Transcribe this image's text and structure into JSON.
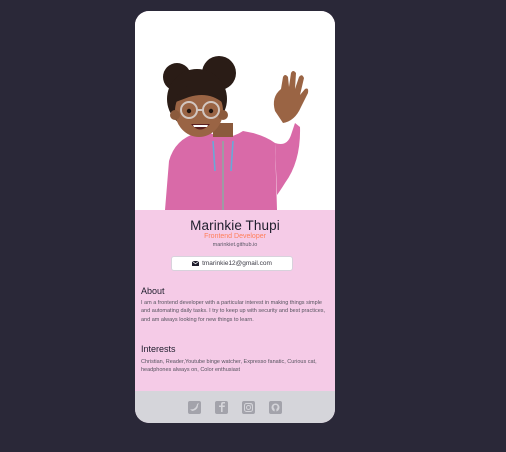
{
  "profile": {
    "name": "Marinkie Thupi",
    "role": "Frontend Developer",
    "website": "marinkiet.github.io",
    "email": "tmarinkie12@gmail.com"
  },
  "about": {
    "title": "About",
    "text": "I am a frontend developer with a particular interest in making things simple and automating daily tasks. I try to keep up with security and best practices, and am always looking for new things to learn."
  },
  "interests": {
    "title": "Interests",
    "text": "Christian, Reader,Youtube binge watcher, Expresso fanatic, Curious cat, headphones always on, Color enthusiast"
  },
  "social": [
    {
      "name": "twitter-icon"
    },
    {
      "name": "facebook-icon"
    },
    {
      "name": "instagram-icon"
    },
    {
      "name": "github-icon"
    }
  ],
  "colors": {
    "background": "#2a2838",
    "card": "#f5cbe7",
    "accent": "#ff7f5a",
    "footer": "#d5d5da"
  }
}
